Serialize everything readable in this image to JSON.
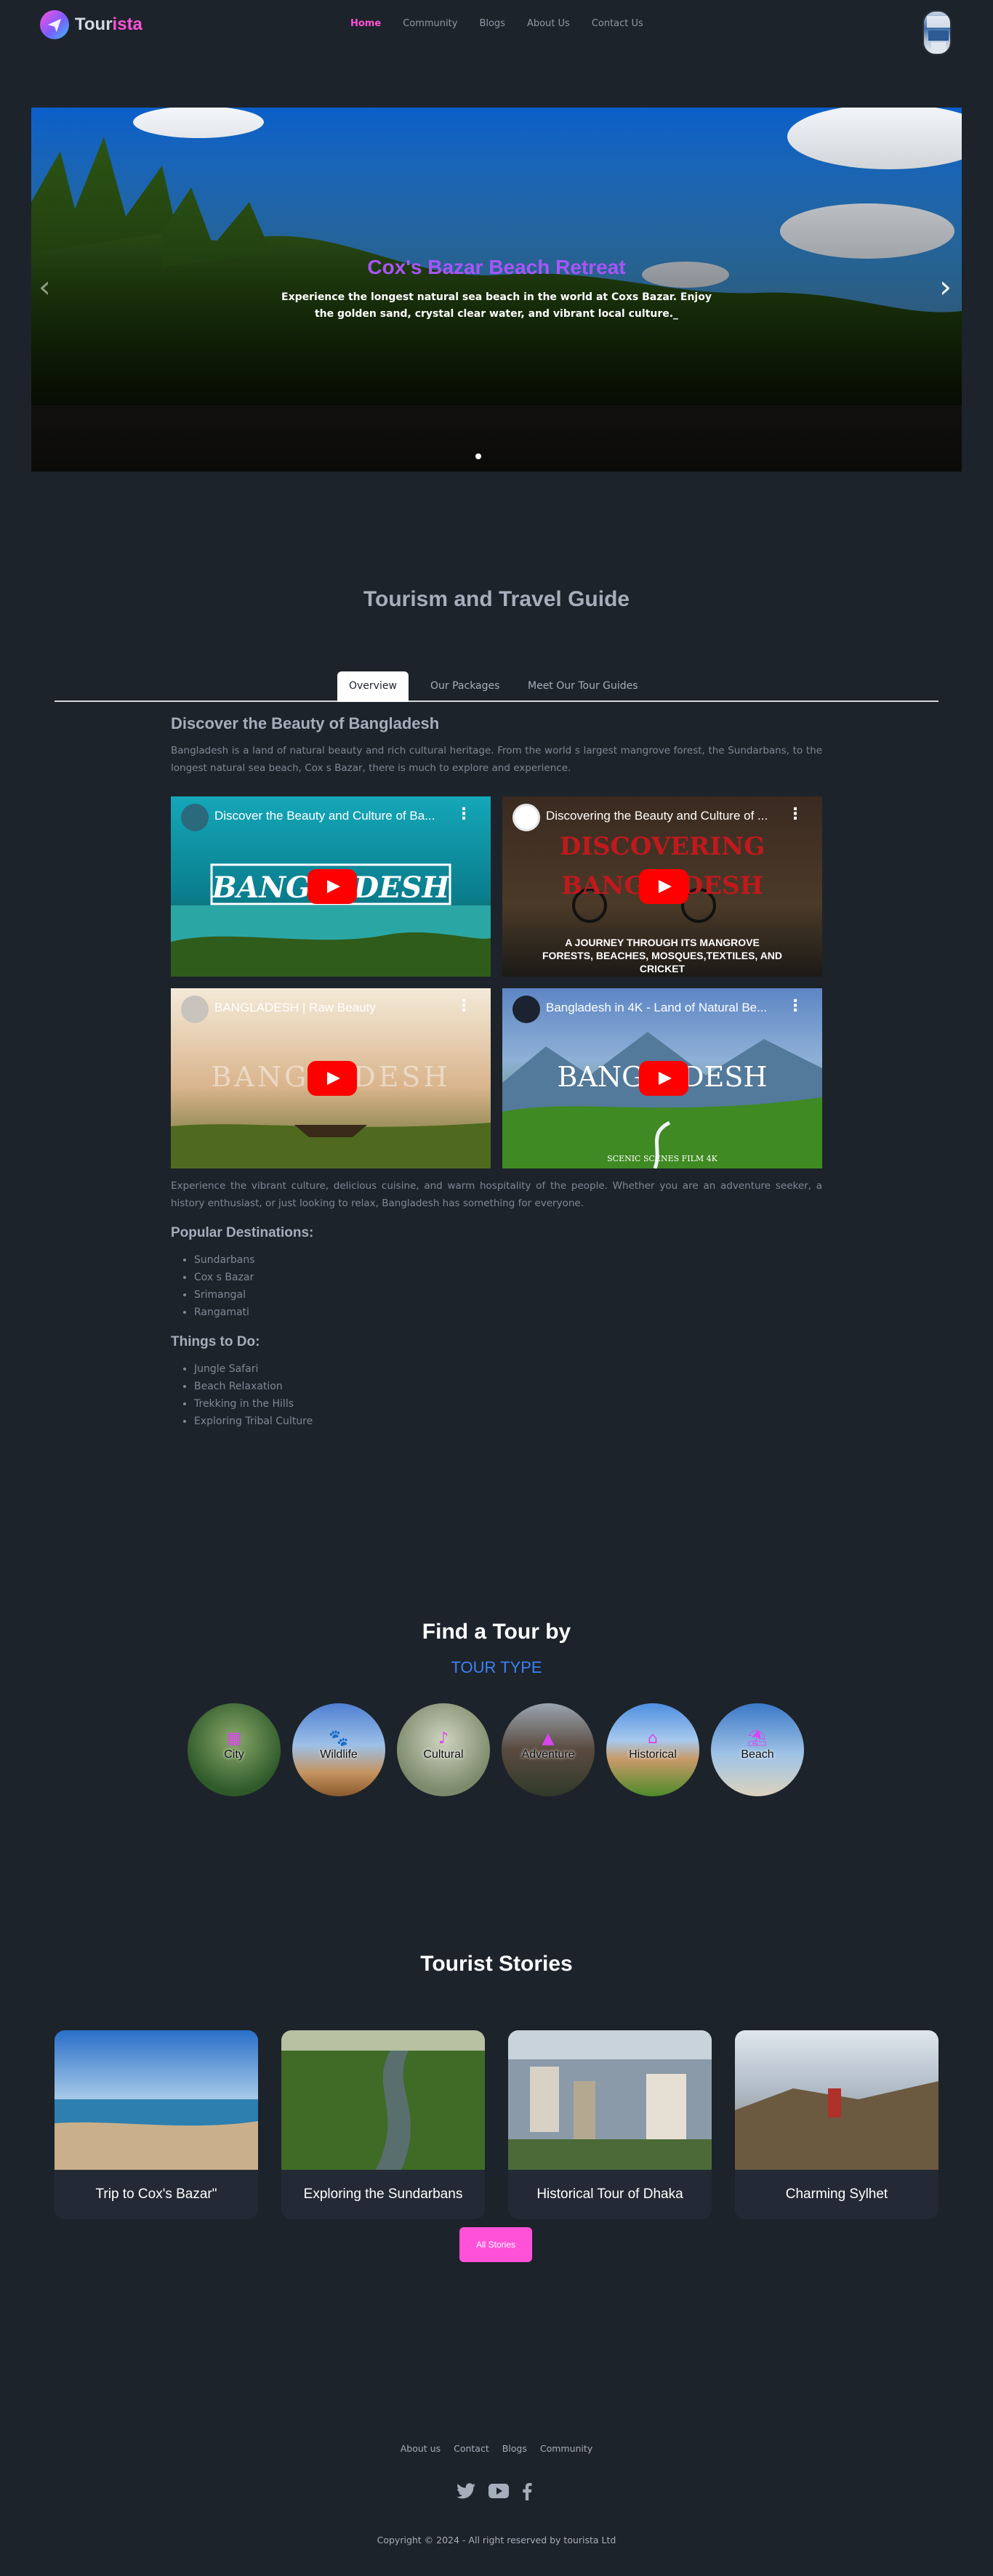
{
  "nav": {
    "logo_prefix": "Tour",
    "logo_suffix": "ista",
    "links": [
      "Home",
      "Community",
      "Blogs",
      "About Us",
      "Contact Us"
    ],
    "active": "Home"
  },
  "hero": {
    "title": "Cox's Bazar Beach Retreat",
    "description": "Experience the longest natural sea beach in the world at Coxs Bazar. Enjoy the golden sand, crystal clear water, and vibrant local culture._",
    "prev_icon": "chevron-left-icon",
    "next_icon": "chevron-right-icon"
  },
  "guide": {
    "title": "Tourism and Travel Guide",
    "tabs": [
      "Overview",
      "Our Packages",
      "Meet Our Tour Guides"
    ],
    "active_tab": "Overview",
    "heading": "Discover the Beauty of Bangladesh",
    "intro": "Bangladesh is a land of natural beauty and rich cultural heritage. From the world s largest mangrove forest, the Sundarbans, to the longest natural sea beach, Cox s Bazar, there is much to explore and experience.",
    "videos": [
      {
        "title": "Discover the Beauty and Culture of Ba...",
        "overlay": "BANGLADESH"
      },
      {
        "title": "Discovering the Beauty and Culture of ...",
        "overlay": "DISCOVERING BANGLADESH",
        "overlay_sub": "A JOURNEY THROUGH ITS MANGROVE FORESTS, BEACHES, MOSQUES,TEXTILES, AND CRICKET"
      },
      {
        "title": "BANGLADESH | Raw Beauty",
        "overlay": "BANGLADESH"
      },
      {
        "title": "Bangladesh in 4K - Land of Natural Be...",
        "overlay": "BANGLADESH",
        "overlay_sub": "SCENIC SCENES FILM 4K"
      }
    ],
    "outro": "Experience the vibrant culture, delicious cuisine, and warm hospitality of the people. Whether you are an adventure seeker, a history enthusiast, or just looking to relax, Bangladesh has something for everyone.",
    "destinations_heading": "Popular Destinations:",
    "destinations": [
      "Sundarbans",
      "Cox s Bazar",
      "Srimangal",
      "Rangamati"
    ],
    "things_heading": "Things to Do:",
    "things": [
      "Jungle Safari",
      "Beach Relaxation",
      "Trekking in the Hills",
      "Exploring Tribal Culture"
    ]
  },
  "find_tour": {
    "title": "Find a Tour by",
    "subtitle": "TOUR TYPE",
    "types": [
      "City",
      "Wildlife",
      "Cultural",
      "Adventure",
      "Historical",
      "Beach"
    ]
  },
  "stories": {
    "title": "Tourist Stories",
    "items": [
      "Trip to Cox's Bazar\"",
      "Exploring the Sundarbans",
      "Historical Tour of Dhaka",
      "Charming Sylhet"
    ],
    "button": "All Stories"
  },
  "footer": {
    "links": [
      "About us",
      "Contact",
      "Blogs",
      "Community"
    ],
    "socials": [
      "twitter-icon",
      "youtube-icon",
      "facebook-icon"
    ],
    "copyright": "Copyright © 2024 - All right reserved by tourista Ltd"
  },
  "colors": {
    "background": "#1d232a",
    "accent": "#ff52d9",
    "hero_title": "#a855f7",
    "subtitle_blue": "#3b82f6"
  }
}
